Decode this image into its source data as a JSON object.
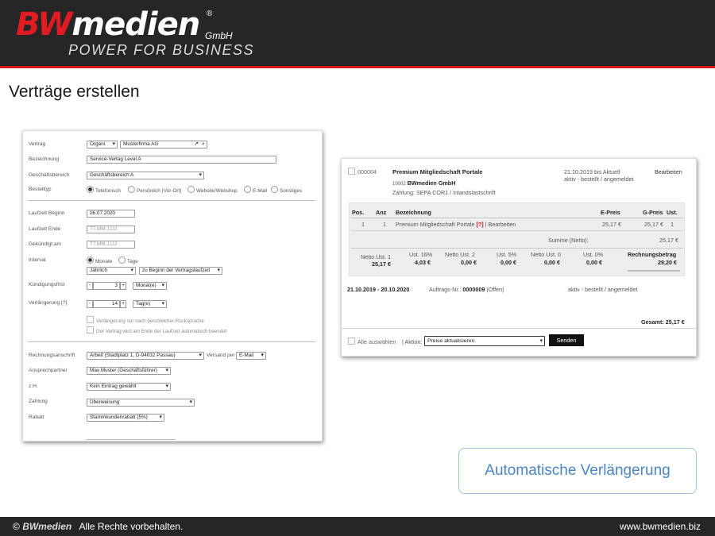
{
  "header": {
    "logo_bw": "BW",
    "logo_medien": "medien",
    "logo_reg": "®",
    "logo_gmbh": "GmbH",
    "logo_tagline": "POWER FOR BUSINESS"
  },
  "slide_title": "Verträge erstellen",
  "form": {
    "vertrag": {
      "label": "Vertrag",
      "type_value": "Organi",
      "customer_value": "Musterfirma AG"
    },
    "bezeichnung": {
      "label": "Bezeichnung",
      "value": "Service-Vertag Level A"
    },
    "geschaeftsbereich": {
      "label": "Geschäftsbereich",
      "value": "Geschäftsbereich A"
    },
    "bestelltyp": {
      "label": "Bestelltyp",
      "options": [
        "Telefonisch",
        "Persönlich (Vor-Ort)",
        "Website/Webshop",
        "E-Mail",
        "Sonstiges"
      ],
      "selected": "Telefonisch"
    },
    "laufzeit_beginn": {
      "label": "Laufzeit Beginn",
      "value": "06.07.2020"
    },
    "laufzeit_ende": {
      "label": "Laufzeit Ende",
      "placeholder": "TT.MM.JJJJ"
    },
    "gekuendigt_am": {
      "label": "Gekündigt am",
      "placeholder": "TT.MM.JJJJ"
    },
    "interval": {
      "label": "Interval",
      "options": [
        "Monate",
        "Tage"
      ],
      "selected": "Monate",
      "frequency_value": "Jährlich",
      "start_value": "zu Beginn der Vertragslaufzeit"
    },
    "kuendigungsfrist": {
      "label": "Kündigungsfrist",
      "minus": "-",
      "value": "3",
      "plus": "+",
      "unit_value": "Monat(e)"
    },
    "verlaengerung": {
      "label": "Verlängerung [?]",
      "minus": "-",
      "value": "14",
      "plus": "+",
      "unit_value": "Tag(e)"
    },
    "checkboxes": [
      "Verlängerung nur nach persönlicher Rücksprache",
      "Der Vertrag wird am Ende der Laufzeit automatisch beendet"
    ],
    "rechnungsanschrift": {
      "label": "Rechnungsanschrift",
      "value": "Arbeit (Stadtplatz 1, D-94032 Passau)",
      "versand_label": "Versand per",
      "versand_value": "E-Mail"
    },
    "ansprechpartner": {
      "label": "Ansprechpartner",
      "value": "Max Muster (Geschäftsführer)"
    },
    "zh": {
      "label": "z.H.",
      "value": "Kein Eintrag gewählt"
    },
    "zahlung": {
      "label": "Zahlung",
      "value": "Überweisung"
    },
    "rabatt": {
      "label": "Rabatt",
      "value": "Stammkundenrabatt (5%)"
    }
  },
  "order": {
    "number": "000004",
    "title": "Premium Mitgliedschaft Portale",
    "customer_number": "10002",
    "customer_name": "BWmedien GmbH",
    "payment": "Zahlung: SEPA COR1 / Inlandslastschrift",
    "date_info": "21.10.2019 bis Aktuell",
    "status_info": "aktiv - bestellt / angemeldet",
    "edit_link": "Bearbeiten",
    "table_headers": {
      "pos": "Pos.",
      "anz": "Anz",
      "bez": "Bezeichnung",
      "epreis": "E-Preis",
      "gpreis": "G-Preis",
      "ust": "Ust."
    },
    "row": {
      "pos": "1",
      "anz": "1",
      "bez": "Premium Mitgliedschaft Portale",
      "help": "[?]",
      "edit": "| Bearbeiten",
      "epreis": "25,17 €",
      "gpreis": "25,17 €",
      "ust": "1"
    },
    "summe_label": "Summe (Netto):",
    "summe_value": "25,17 €",
    "tax": [
      {
        "label": "Netto Ust. 1",
        "value": "25,17 €"
      },
      {
        "label": "Ust. 16%",
        "value": "4,03 €"
      },
      {
        "label": "Netto Ust. 2",
        "value": "0,00 €"
      },
      {
        "label": "Ust. 5%",
        "value": "0,00 €"
      },
      {
        "label": "Netto Ust. 0",
        "value": "0,00 €"
      },
      {
        "label": "Ust. 0%",
        "value": "0,00 €"
      }
    ],
    "rechnungsbetrag_label": "Rechnungsbetrag",
    "rechnungsbetrag_value": "29,20 €",
    "period": "21.10.2019 - 20.10.2020",
    "auftrag_label": "Auftrags-Nr.:",
    "auftrag_number": "0000009",
    "auftrag_status": "(Offen)",
    "period_status": "aktiv - bestellt / angemeldet",
    "gesamt": "Gesamt: 25,17 €",
    "select_all": "Alle auswählen",
    "aktion_label": "| Aktion:",
    "aktion_value": "Preise aktualisieren",
    "send_button": "Senden"
  },
  "callout": "Automatische Verlängerung",
  "footer": {
    "copyright": "©",
    "brand": "BWmedien",
    "rights": "Alle Rechte vorbehalten.",
    "url": "www.bwmedien.biz"
  }
}
